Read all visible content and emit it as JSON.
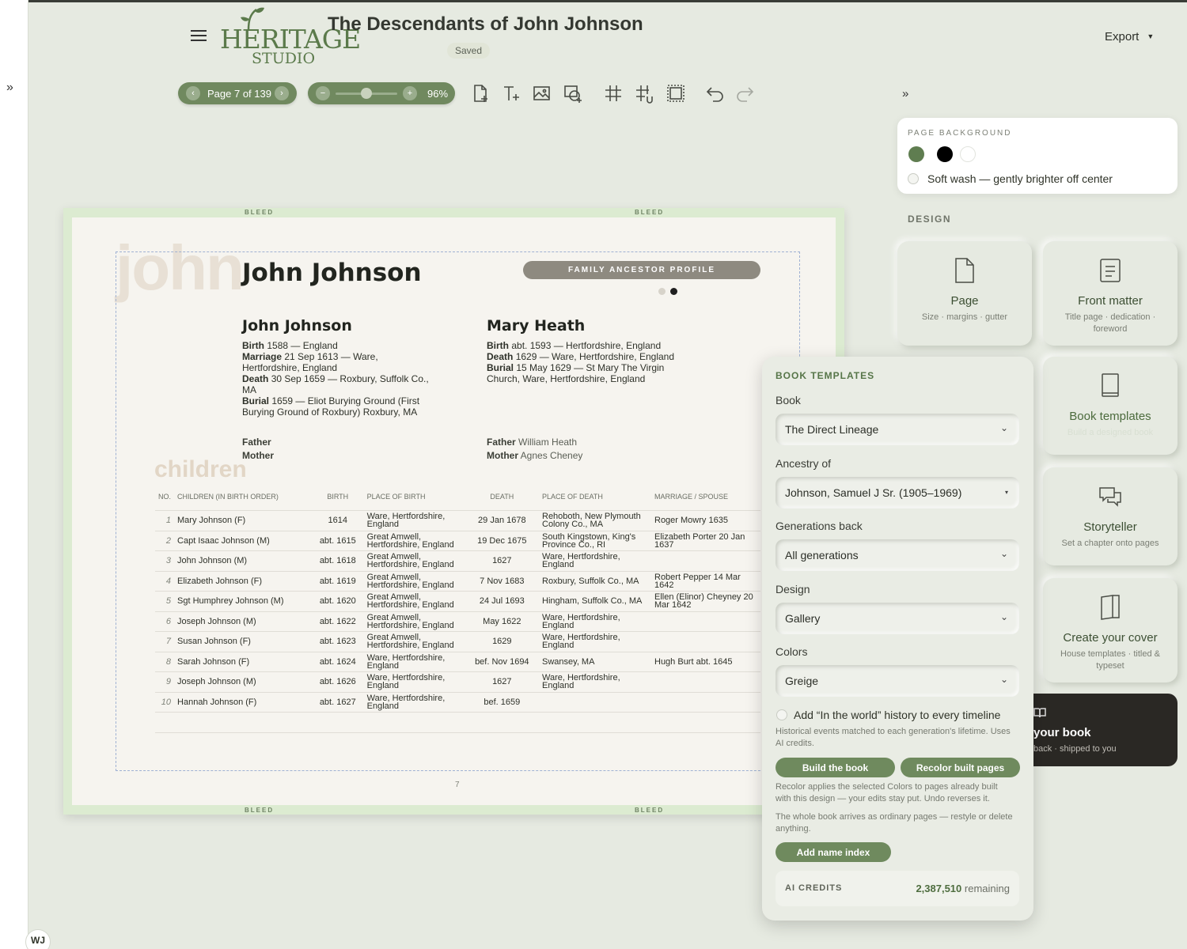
{
  "app": {
    "logo_main": "HERITAGE",
    "logo_sub": "STUDIO",
    "title": "The Descendants of John Johnson",
    "saved": "Saved",
    "export": "Export",
    "user_initials": "WJ"
  },
  "toolbar": {
    "page_label": "Page 7 of 139",
    "zoom_label": "96%",
    "zoom_level": 0.5
  },
  "canvas": {
    "bleed": "BLEED",
    "watermark": "john",
    "name": "John Johnson",
    "tag": "FAMILY ANCESTOR PROFILE",
    "page_number": "7",
    "children_title": "children",
    "person1": {
      "name": "John Johnson",
      "birth_k": "Birth",
      "birth": "1588 — England",
      "marriage_k": "Marriage",
      "marriage": "21 Sep 1613 — Ware, Hertfordshire, England",
      "death_k": "Death",
      "death": "30 Sep 1659 — Roxbury, Suffolk Co., MA",
      "burial_k": "Burial",
      "burial": "1659 — Eliot Burying Ground (First Burying Ground of Roxbury) Roxbury, MA",
      "father_k": "Father",
      "father": "",
      "mother_k": "Mother",
      "mother": ""
    },
    "person2": {
      "name": "Mary Heath",
      "birth_k": "Birth",
      "birth": "abt. 1593 — Hertfordshire, England",
      "death_k": "Death",
      "death": "1629 — Ware, Hertfordshire, England",
      "burial_k": "Burial",
      "burial": "15 May 1629 — St Mary The Virgin Church, Ware, Hertfordshire, England",
      "father_k": "Father",
      "father": "William Heath",
      "mother_k": "Mother",
      "mother": "Agnes Cheney"
    },
    "table_headers": [
      "NO.",
      "CHILDREN (IN BIRTH ORDER)",
      "BIRTH",
      "PLACE OF BIRTH",
      "DEATH",
      "PLACE OF DEATH",
      "MARRIAGE / SPOUSE"
    ],
    "children": [
      [
        "1",
        "Mary Johnson (F)",
        "1614",
        "Ware, Hertfordshire, England",
        "29 Jan 1678",
        "Rehoboth, New Plymouth Colony Co., MA",
        "Roger Mowry 1635"
      ],
      [
        "2",
        "Capt Isaac Johnson (M)",
        "abt. 1615",
        "Great Amwell, Hertfordshire, England",
        "19 Dec 1675",
        "South Kingstown, King's Province Co., RI",
        "Elizabeth Porter 20 Jan 1637"
      ],
      [
        "3",
        "John Johnson (M)",
        "abt. 1618",
        "Great Amwell, Hertfordshire, England",
        "1627",
        "Ware, Hertfordshire, England",
        ""
      ],
      [
        "4",
        "Elizabeth Johnson (F)",
        "abt. 1619",
        "Great Amwell, Hertfordshire, England",
        "7 Nov 1683",
        "Roxbury, Suffolk Co., MA",
        "Robert Pepper 14 Mar 1642"
      ],
      [
        "5",
        "Sgt Humphrey Johnson (M)",
        "abt. 1620",
        "Great Amwell, Hertfordshire, England",
        "24 Jul 1693",
        "Hingham, Suffolk Co., MA",
        "Ellen (Elinor) Cheyney 20 Mar 1642"
      ],
      [
        "6",
        "Joseph Johnson (M)",
        "abt. 1622",
        "Great Amwell, Hertfordshire, England",
        "May 1622",
        "Ware, Hertfordshire, England",
        ""
      ],
      [
        "7",
        "Susan Johnson (F)",
        "abt. 1623",
        "Great Amwell, Hertfordshire, England",
        "1629",
        "Ware, Hertfordshire, England",
        ""
      ],
      [
        "8",
        "Sarah Johnson (F)",
        "abt. 1624",
        "Ware, Hertfordshire, England",
        "bef. Nov 1694",
        "Swansey, MA",
        "Hugh Burt abt. 1645"
      ],
      [
        "9",
        "Joseph Johnson (M)",
        "abt. 1626",
        "Ware, Hertfordshire, England",
        "1627",
        "Ware, Hertfordshire, England",
        ""
      ],
      [
        "10",
        "Hannah Johnson (F)",
        "abt. 1627",
        "Ware, Hertfordshire, England",
        "bef. 1659",
        "",
        ""
      ]
    ]
  },
  "panel": {
    "bg_title": "PAGE BACKGROUND",
    "swatches": [
      "#5f7d50",
      "#000000",
      "#ffffff"
    ],
    "wash_label": "Soft wash — gently brighter off center",
    "design_head": "DESIGN",
    "tiles": {
      "page": {
        "t": "Page",
        "s": "Size · margins · gutter"
      },
      "front": {
        "t": "Front matter",
        "s": "Title page · dedication · foreword"
      },
      "templates": {
        "t": "Book templates",
        "s": "Build a designed book"
      },
      "story": {
        "t": "Storyteller",
        "s": "Set a chapter onto pages"
      },
      "cover": {
        "t": "Create your cover",
        "s": "House templates · titled & typeset"
      }
    },
    "print": {
      "t": "your book",
      "s": "back · shipped to you"
    }
  },
  "templates": {
    "title": "BOOK TEMPLATES",
    "book_label": "Book",
    "book_value": "The Direct Lineage",
    "ancestry_label": "Ancestry of",
    "ancestry_value": "Johnson, Samuel J Sr. (1905–1969)",
    "gen_label": "Generations back",
    "gen_value": "All generations",
    "design_label": "Design",
    "design_value": "Gallery",
    "colors_label": "Colors",
    "colors_value": "Greige",
    "history_label": "Add “In the world” history to every timeline",
    "history_note": "Historical events matched to each generation's lifetime. Uses AI credits.",
    "build_btn": "Build the book",
    "recolor_btn": "Recolor built pages",
    "recolor_note": "Recolor applies the selected Colors to pages already built with this design — your edits stay put. Undo reverses it.",
    "whole_note": "The whole book arrives as ordinary pages — restyle or delete anything.",
    "index_btn": "Add name index",
    "credits_label": "AI CREDITS",
    "credits_value": "2,387,510",
    "credits_suffix": "remaining"
  }
}
